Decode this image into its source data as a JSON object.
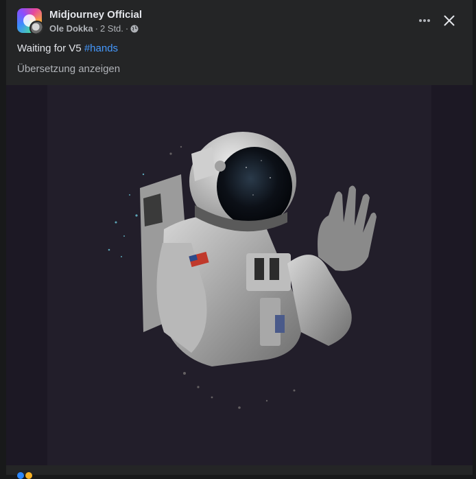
{
  "post": {
    "page_name": "Midjourney Official",
    "author": "Ole Dokka",
    "time": "2 Std.",
    "separator": "·",
    "text": "Waiting for V5",
    "hashtag": "#hands",
    "translate_label": "Übersetzung anzeigen",
    "more_icon": "ellipsis-icon",
    "close_icon": "close-icon",
    "privacy_icon": "globe-icon",
    "image_description": "astronaut-illustration"
  },
  "colors": {
    "background": "#242526",
    "hashtag": "#4599ff",
    "secondary_text": "#b0b3b8"
  }
}
